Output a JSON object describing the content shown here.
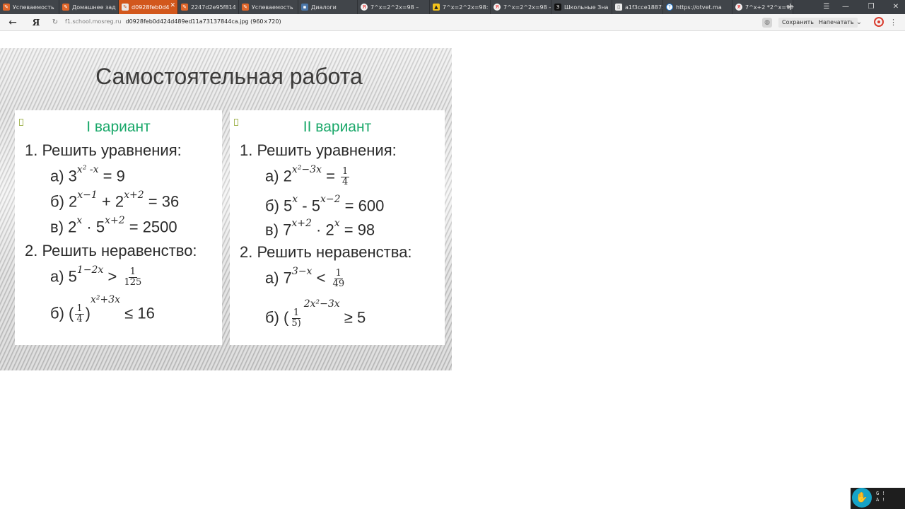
{
  "tabs": [
    {
      "title": "Успеваемость",
      "icon": "orange-doc-icon",
      "glyph": "✎",
      "fav": "orange"
    },
    {
      "title": "Домашнее зад",
      "icon": "orange-doc-icon",
      "glyph": "✎",
      "fav": "orange"
    },
    {
      "title": "d0928feb0d4",
      "icon": "orange-doc-icon",
      "glyph": "✎",
      "fav": "white",
      "active": true
    },
    {
      "title": "2247d2e95f814",
      "icon": "orange-doc-icon",
      "glyph": "✎",
      "fav": "orange"
    },
    {
      "title": "Успеваемость",
      "icon": "orange-doc-icon",
      "glyph": "✎",
      "fav": "orange"
    },
    {
      "title": "Диалоги",
      "icon": "vk-icon",
      "glyph": "▪",
      "fav": "vk"
    },
    {
      "title": "7^x=2^2x=98 –",
      "icon": "yandex-icon",
      "glyph": "Я",
      "fav": "ya"
    },
    {
      "title": "7^x=2^2x=98:",
      "icon": "yellow-icon",
      "glyph": "▲",
      "fav": "yellow"
    },
    {
      "title": "7^x=2^2x=98 –",
      "icon": "yandex-icon",
      "glyph": "Я",
      "fav": "ya"
    },
    {
      "title": "Школьные Зна",
      "icon": "znanija-icon",
      "glyph": "З",
      "fav": "school"
    },
    {
      "title": "a1f3cce18875cf",
      "icon": "document-icon",
      "glyph": "▯",
      "fav": "doc"
    },
    {
      "title": "https://otvet.ma",
      "icon": "question-icon",
      "glyph": "?",
      "fav": "q"
    },
    {
      "title": "7^x+2 *2^x=98",
      "icon": "yandex-icon",
      "glyph": "Я",
      "fav": "ya"
    }
  ],
  "window_controls": {
    "menu": "☰",
    "minimize": "—",
    "restore": "❐",
    "close": "✕"
  },
  "addressbar": {
    "back": "←",
    "yandex_button": "Я",
    "reload": "↻",
    "domain": "f1.school.mosreg.ru",
    "path": "d0928feb0d424d489ed11a73137844ca.jpg (960×720)",
    "save_label": "Сохранить",
    "print_label": "Напечатать",
    "chevron": "⌄",
    "menu": "⋮"
  },
  "slide": {
    "title": "Самостоятельная работа",
    "variant1": {
      "heading": "I  вариант",
      "task1_heading": "1. Решить уравнения:",
      "task1": [
        {
          "label": "а) 3",
          "exp": "x² -x",
          "rest": " = 9"
        },
        {
          "label": "б) 2",
          "exp": "x−1",
          "mid": " + 2",
          "exp2": "x+2",
          "rest": " = 36"
        },
        {
          "label": "в) 2",
          "exp": "x",
          "mid": " · 5",
          "exp2": "x+2",
          "rest": " = 2500"
        }
      ],
      "task2_heading": "2. Решить неравенство:",
      "task2": [
        {
          "label": "а) 5",
          "exp": "1−2x",
          "rest": " > ",
          "frac_num": "1",
          "frac_den": "125"
        },
        {
          "label": "б) (",
          "frac_num": "1",
          "frac_den": "4",
          "close": ")",
          "exp": "x²+3x",
          "rest": "  ≤ 16"
        }
      ]
    },
    "variant2": {
      "heading": "II  вариант",
      "task1_heading": "1. Решить уравнения:",
      "task1": [
        {
          "label": "а) 2",
          "exp": "x²−3x",
          "rest": " = ",
          "frac_num": "1",
          "frac_den": "4"
        },
        {
          "label": "б) 5",
          "exp": "x",
          "mid": " - 5",
          "exp2": "x−2",
          "rest": " = 600"
        },
        {
          "label": "в) 7",
          "exp": "x+2",
          "mid": " · 2",
          "exp2": "x",
          "rest": " = 98"
        }
      ],
      "task2_heading": "2. Решить неравенства:",
      "task2": [
        {
          "label": "а) 7",
          "exp": "3−x",
          "rest": " < ",
          "frac_num": "1",
          "frac_den": "49"
        },
        {
          "label": "б) (",
          "frac_num": "1",
          "frac_den": "5)",
          "close": ")",
          "exp": "2x²−3x",
          "rest": "  ≥ 5"
        }
      ]
    }
  },
  "corner_widget": {
    "line1": "G !",
    "line2": "A !"
  }
}
